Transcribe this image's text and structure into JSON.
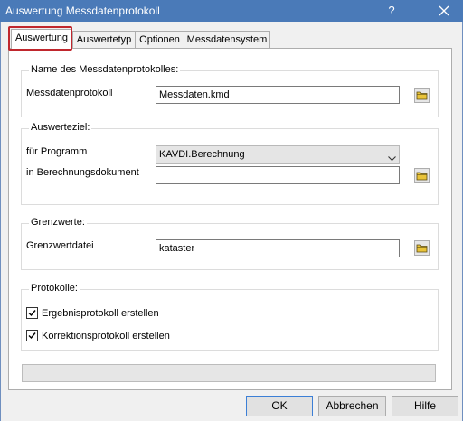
{
  "window": {
    "title": "Auswertung Messdatenprotokoll",
    "help_label": "?"
  },
  "tabs": [
    {
      "label": "Auswertung",
      "active": true
    },
    {
      "label": "Auswertetyp",
      "active": false
    },
    {
      "label": "Optionen",
      "active": false
    },
    {
      "label": "Messdatensystem",
      "active": false
    }
  ],
  "group_name": {
    "legend": "Name des Messdatenprotokolles:",
    "field_label": "Messdatenprotokoll",
    "field_value": "Messdaten.kmd"
  },
  "group_target": {
    "legend": "Auswerteziel:",
    "program_label": "für Programm",
    "program_value": "KAVDI.Berechnung",
    "document_label": "in Berechnungsdokument",
    "document_value": ""
  },
  "group_limits": {
    "legend": "Grenzwerte:",
    "file_label": "Grenzwertdatei",
    "file_value": "kataster"
  },
  "group_protocols": {
    "legend": "Protokolle:",
    "checkbox1_label": "Ergebnisprotokoll erstellen",
    "checkbox1_checked": true,
    "checkbox2_label": "Korrektionsprotokoll erstellen",
    "checkbox2_checked": true
  },
  "progress": {
    "value": 0
  },
  "buttons": {
    "ok": "OK",
    "cancel": "Abbrechen",
    "help": "Hilfe"
  },
  "colors": {
    "titlebar": "#4a7ab8",
    "tab_highlight": "#c0272d",
    "folder_icon": "#e8c33a"
  },
  "icons": {
    "browse": "folder-icon",
    "close": "close-icon",
    "dropdown": "chevron-down-icon",
    "check": "checkmark-icon"
  }
}
